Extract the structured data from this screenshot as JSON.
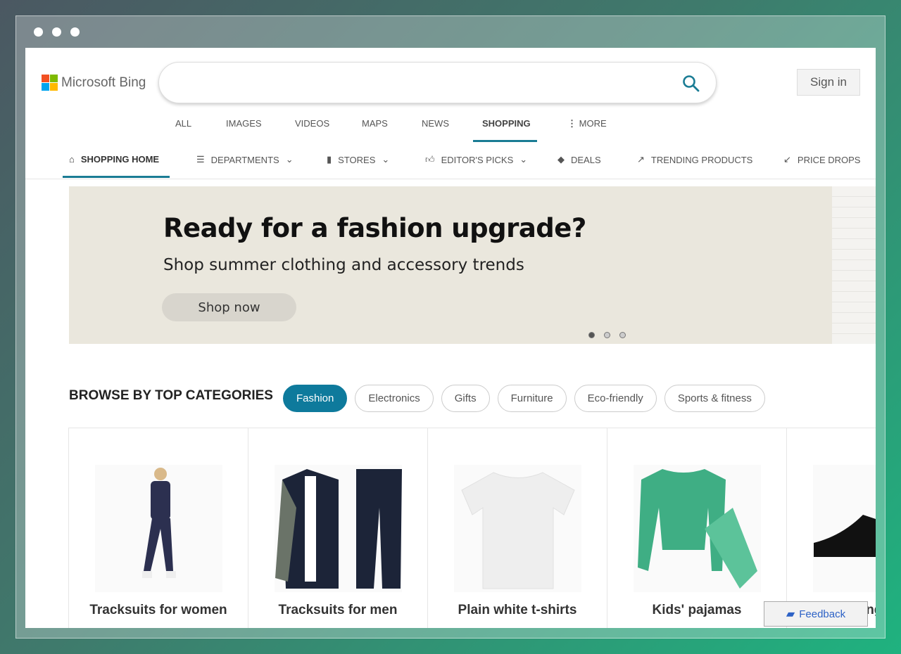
{
  "brand": {
    "name": "Microsoft Bing",
    "colors": [
      "#f25022",
      "#7fba00",
      "#00a4ef",
      "#ffb900"
    ]
  },
  "search": {
    "value": "",
    "placeholder": ""
  },
  "sign_in": "Sign in",
  "tabs": [
    {
      "label": "ALL"
    },
    {
      "label": "IMAGES"
    },
    {
      "label": "VIDEOS"
    },
    {
      "label": "MAPS"
    },
    {
      "label": "NEWS"
    },
    {
      "label": "SHOPPING",
      "active": true
    },
    {
      "label": "MORE",
      "icon": "more-vertical-icon"
    }
  ],
  "subnav": [
    {
      "label": "SHOPPING HOME",
      "icon": "home-icon",
      "active": true
    },
    {
      "label": "DEPARTMENTS",
      "icon": "list-icon",
      "dropdown": true
    },
    {
      "label": "STORES",
      "icon": "bag-icon",
      "dropdown": true
    },
    {
      "label": "EDITOR'S PICKS",
      "icon": "thumbs-up-icon",
      "dropdown": true
    },
    {
      "label": "DEALS",
      "icon": "tag-icon"
    },
    {
      "label": "TRENDING PRODUCTS",
      "icon": "trending-up-icon"
    },
    {
      "label": "PRICE DROPS",
      "icon": "trending-down-icon"
    }
  ],
  "hero": {
    "title": "Ready for a fashion upgrade?",
    "subtitle": "Shop summer clothing and accessory trends",
    "button": "Shop now",
    "slides": 3,
    "active_slide": 1
  },
  "categories": {
    "title": "BROWSE BY TOP CATEGORIES",
    "chips": [
      {
        "label": "Fashion",
        "active": true
      },
      {
        "label": "Electronics"
      },
      {
        "label": "Gifts"
      },
      {
        "label": "Furniture"
      },
      {
        "label": "Eco-friendly"
      },
      {
        "label": "Sports & fitness"
      }
    ]
  },
  "products": [
    {
      "label": "Tracksuits for women"
    },
    {
      "label": "Tracksuits for men"
    },
    {
      "label": "Plain white t-shirts"
    },
    {
      "label": "Kids' pajamas"
    },
    {
      "label": "Running shoes"
    }
  ],
  "feedback": "Feedback",
  "accent": "#1a7c94"
}
